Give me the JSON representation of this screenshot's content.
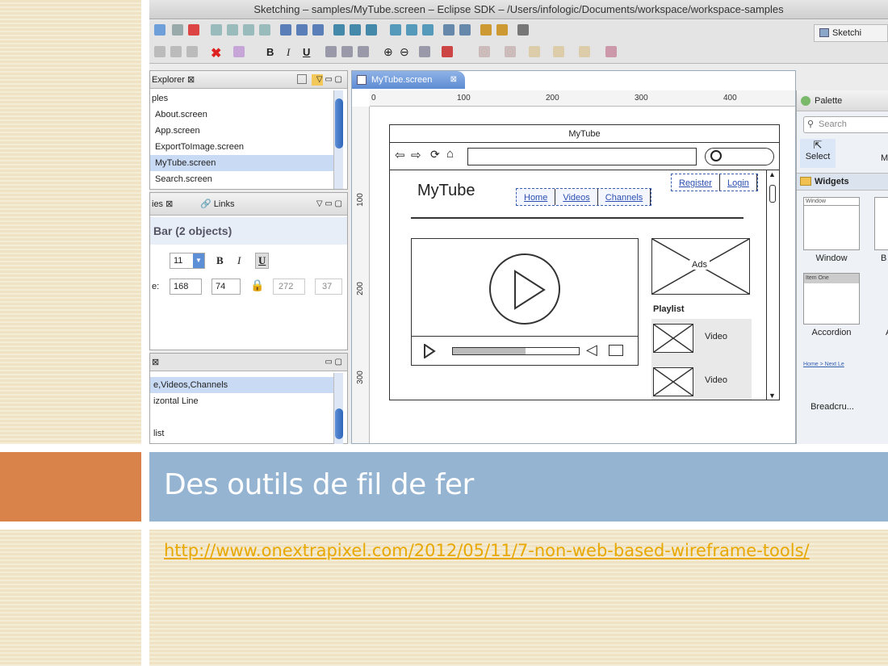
{
  "window": {
    "title": "Sketching – samples/MyTube.screen – Eclipse SDK – /Users/infologic/Documents/workspace/workspace-samples",
    "perspective_label": "Sketchi"
  },
  "explorer": {
    "tab_label": "Explorer",
    "items": [
      "ples",
      "About.screen",
      "App.screen",
      "ExportToImage.screen",
      "MyTube.screen",
      "Search.screen"
    ],
    "selected_index": 4
  },
  "properties": {
    "tab_label": "ies",
    "links_tab": "Links",
    "header": "Bar (2 objects)",
    "font_size": "11",
    "bold_label": "B",
    "italic_label": "I",
    "underline_label": "U",
    "pos_prefix": "e:",
    "x": "168",
    "y": "74",
    "w": "272",
    "h": "37"
  },
  "outline": {
    "items": [
      "e,Videos,Channels",
      "izontal Line",
      "",
      "list"
    ],
    "selected_index": 0
  },
  "editor": {
    "tab_label": "MyTube.screen",
    "ruler_top": [
      "0",
      "100",
      "200",
      "300",
      "400"
    ],
    "ruler_left": [
      "100",
      "200",
      "300"
    ],
    "mockup": {
      "window_title": "MyTube",
      "site_title": "MyTube",
      "nav_links": [
        "Home",
        "Videos",
        "Channels"
      ],
      "auth_links": [
        "Register",
        "Login"
      ],
      "ads_label": "Ads",
      "playlist_label": "Playlist",
      "video_labels": [
        "Video",
        "Video"
      ]
    }
  },
  "palette": {
    "title": "Palette",
    "search_placeholder": "Search",
    "select_label": "Select",
    "m_label": "M",
    "section": "Widgets",
    "items": [
      "Window",
      "B",
      "Accordion",
      "A",
      "Breadcru..."
    ],
    "breadcrumb_sample": "Home > Next Le",
    "accordion_sample": "Item One",
    "window_sample": "Window"
  },
  "slide": {
    "title": "Des outils de fil de fer",
    "link": "http://www.onextrapixel.com/2012/05/11/7-non-web-based-wireframe-tools/"
  }
}
